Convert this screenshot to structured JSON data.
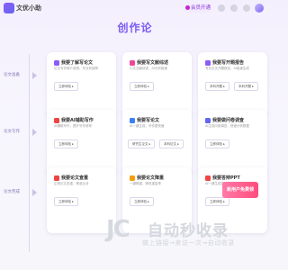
{
  "header": {
    "app_name": "文优小助",
    "vip_label": "会员开通"
  },
  "page_title": "创作论",
  "timeline": {
    "labels": [
      "论文准备",
      "论文写作",
      "论文完成"
    ]
  },
  "cards": [
    {
      "title": "我要了解写论文",
      "desc": "论文写作简介说明，专业有保障",
      "buttons": [
        "立即体验 ▸"
      ],
      "icon_color": "#8b5cf6"
    },
    {
      "title": "我要写文献综述",
      "desc": "小文文献综述，AI分析极速",
      "buttons": [
        "立即体验 ▸"
      ],
      "icon_color": "#ec4899"
    },
    {
      "title": "我要写开题报告",
      "desc": "专业论文开题报告，AI极速生成",
      "buttons": [
        "本科开题 ▸",
        "本科开题 ▸"
      ],
      "icon_color": "#8b5cf6"
    },
    {
      "title": "我要AI辅助写作",
      "desc": "AI辅助写作，提升写作效率",
      "buttons": [
        "立即体验 ▸"
      ],
      "icon_color": "#ef4444"
    },
    {
      "title": "我要写论文",
      "desc": "AI一键生成，写作更快速",
      "buttons": [
        "研究生论文 ▸",
        "本科论文 ▸"
      ],
      "icon_color": "#3b82f6"
    },
    {
      "title": "我要做问卷调查",
      "desc": "AI生成问卷调查，快速分析数据",
      "buttons": [
        "立即体验 ▸"
      ],
      "icon_color": "#6366f1"
    },
    {
      "title": "我要论文查重",
      "desc": "正规论文查重，精准比对",
      "buttons": [
        "立即体验 ▸"
      ],
      "icon_color": "#ef4444"
    },
    {
      "title": "我要论文降重",
      "desc": "一键降重，降低重复率",
      "buttons": [
        "立即体验 ▸"
      ],
      "icon_color": "#f59e0b"
    },
    {
      "title": "我要答辩PPT",
      "desc": "AI一键生成答辩PPT",
      "buttons": [
        "立即体验 ▸"
      ],
      "icon_color": "#ef4444"
    }
  ],
  "promo": "新用户免费领",
  "watermark": {
    "logo": "JC",
    "big": "自动秒收录",
    "small": "做上链接→来访一次→自动收录"
  }
}
